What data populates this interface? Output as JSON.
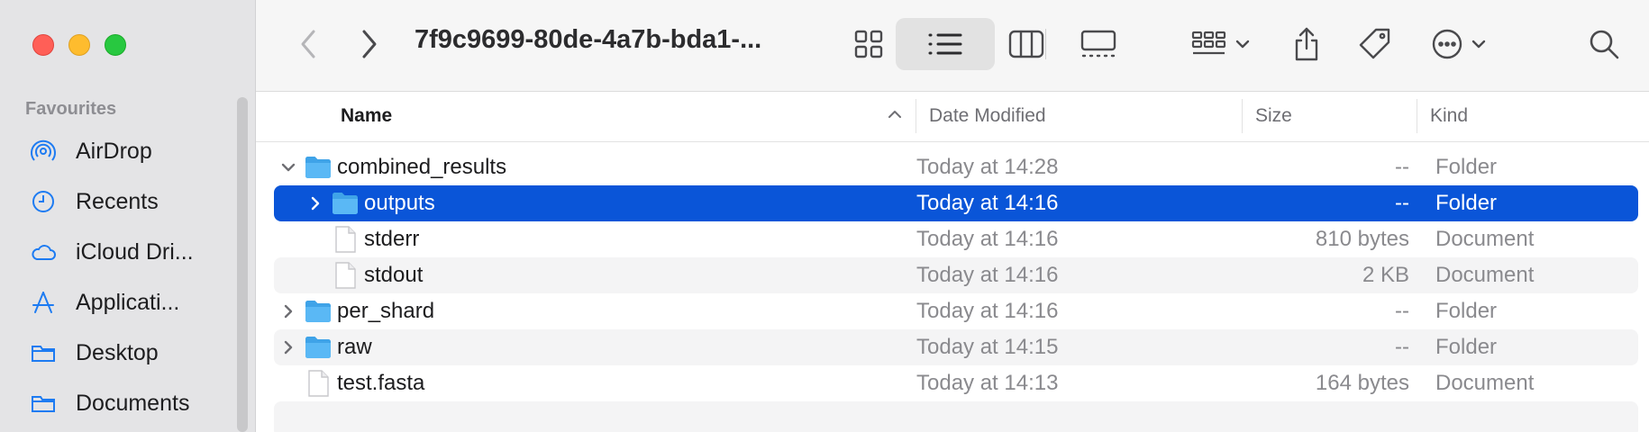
{
  "window": {
    "title": "7f9c9699-80de-4a7b-bda1-..."
  },
  "sidebar": {
    "section_title": "Favourites",
    "items": [
      {
        "label": "AirDrop",
        "icon": "airdrop-icon"
      },
      {
        "label": "Recents",
        "icon": "clock-icon"
      },
      {
        "label": "iCloud Dri...",
        "icon": "cloud-icon"
      },
      {
        "label": "Applicati...",
        "icon": "applications-icon"
      },
      {
        "label": "Desktop",
        "icon": "folder-icon"
      },
      {
        "label": "Documents",
        "icon": "folder-icon"
      }
    ]
  },
  "table": {
    "columns": {
      "name": "Name",
      "date": "Date Modified",
      "size": "Size",
      "kind": "Kind"
    },
    "rows": [
      {
        "name": "combined_results",
        "date": "Today at 14:28",
        "size": "--",
        "kind": "Folder",
        "type": "folder",
        "level": 0,
        "disclosure": "expanded"
      },
      {
        "name": "outputs",
        "date": "Today at 14:16",
        "size": "--",
        "kind": "Folder",
        "type": "folder",
        "level": 1,
        "disclosure": "collapsed",
        "selected": true
      },
      {
        "name": "stderr",
        "date": "Today at 14:16",
        "size": "810 bytes",
        "kind": "Document",
        "type": "document",
        "level": 1
      },
      {
        "name": "stdout",
        "date": "Today at 14:16",
        "size": "2 KB",
        "kind": "Document",
        "type": "document",
        "level": 1
      },
      {
        "name": "per_shard",
        "date": "Today at 14:16",
        "size": "--",
        "kind": "Folder",
        "type": "folder",
        "level": 0,
        "disclosure": "collapsed"
      },
      {
        "name": "raw",
        "date": "Today at 14:15",
        "size": "--",
        "kind": "Folder",
        "type": "folder",
        "level": 0,
        "disclosure": "collapsed"
      },
      {
        "name": "test.fasta",
        "date": "Today at 14:13",
        "size": "164 bytes",
        "kind": "Document",
        "type": "document",
        "level": 0
      }
    ]
  },
  "colors": {
    "selection": "#0a55d8",
    "folder": "#5ab8f5",
    "accent": "#1d7bf2"
  }
}
